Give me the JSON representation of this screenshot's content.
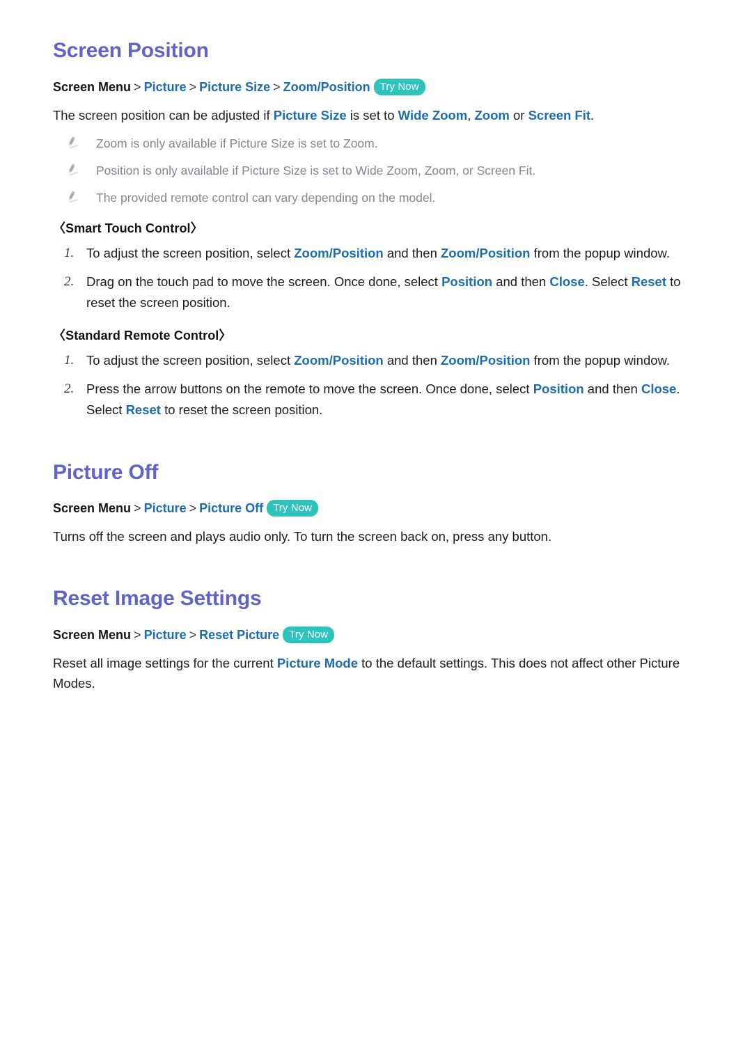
{
  "theme": {
    "heading_color": "#6064c4",
    "link_color": "#1b6db3",
    "note_color": "#83868f",
    "badge_bg": "#2ec4bd",
    "badge_text_color": "#ffffff",
    "body_color": "#1c1c1c",
    "page_bg": "#ffffff"
  },
  "sections": {
    "screen_position": {
      "title": "Screen Position",
      "breadcrumb": {
        "root": "Screen Menu",
        "sep": ">",
        "links": [
          "Picture",
          "Picture Size",
          "Zoom/Position"
        ],
        "badge": "Try Now"
      },
      "intro": {
        "t1": "The screen position can be adjusted if ",
        "l1": "Picture Size",
        "t2": " is set to ",
        "l2": "Wide Zoom",
        "t3": ", ",
        "l3": "Zoom",
        "t4": " or ",
        "l4": "Screen Fit",
        "t5": "."
      },
      "notes": [
        "Zoom is only available if Picture Size is set to Zoom.",
        "Position is only available if Picture Size is set to Wide Zoom, Zoom, or Screen Fit.",
        "The provided remote control can vary depending on the model."
      ],
      "note_icon": "pencil-icon",
      "groups": [
        {
          "heading": "〈Smart Touch Control〉",
          "steps": [
            {
              "num": "1.",
              "t1": "To adjust the screen position, select ",
              "l1": "Zoom/Position",
              "t2": " and then ",
              "l2": "Zoom/Position",
              "t3": " from the popup window."
            },
            {
              "num": "2.",
              "t1": "Drag on the touch pad to move the screen. Once done, select ",
              "l1": "Position",
              "t2": " and then ",
              "l2": "Close",
              "t3": ". Select ",
              "l3": "Reset",
              "t4": " to reset the screen position."
            }
          ]
        },
        {
          "heading": "〈Standard Remote Control〉",
          "steps": [
            {
              "num": "1.",
              "t1": "To adjust the screen position, select ",
              "l1": "Zoom/Position",
              "t2": " and then ",
              "l2": "Zoom/Position",
              "t3": " from the popup window."
            },
            {
              "num": "2.",
              "t1": "Press the arrow buttons on the remote to move the screen. Once done, select ",
              "l1": "Position",
              "t2": " and then ",
              "l2": "Close",
              "t3": ". Select ",
              "l3": "Reset",
              "t4": " to reset the screen position."
            }
          ]
        }
      ]
    },
    "picture_off": {
      "title": "Picture Off",
      "breadcrumb": {
        "root": "Screen Menu",
        "sep": ">",
        "links": [
          "Picture",
          "Picture Off"
        ],
        "badge": "Try Now"
      },
      "body": "Turns off the screen and plays audio only. To turn the screen back on, press any button."
    },
    "reset_image_settings": {
      "title": "Reset Image Settings",
      "breadcrumb": {
        "root": "Screen Menu",
        "sep": ">",
        "links": [
          "Picture",
          "Reset Picture"
        ],
        "badge": "Try Now"
      },
      "body": {
        "t1": "Reset all image settings for the current ",
        "l1": "Picture Mode",
        "t2": " to the default settings. This does not affect other Picture Modes."
      }
    }
  }
}
